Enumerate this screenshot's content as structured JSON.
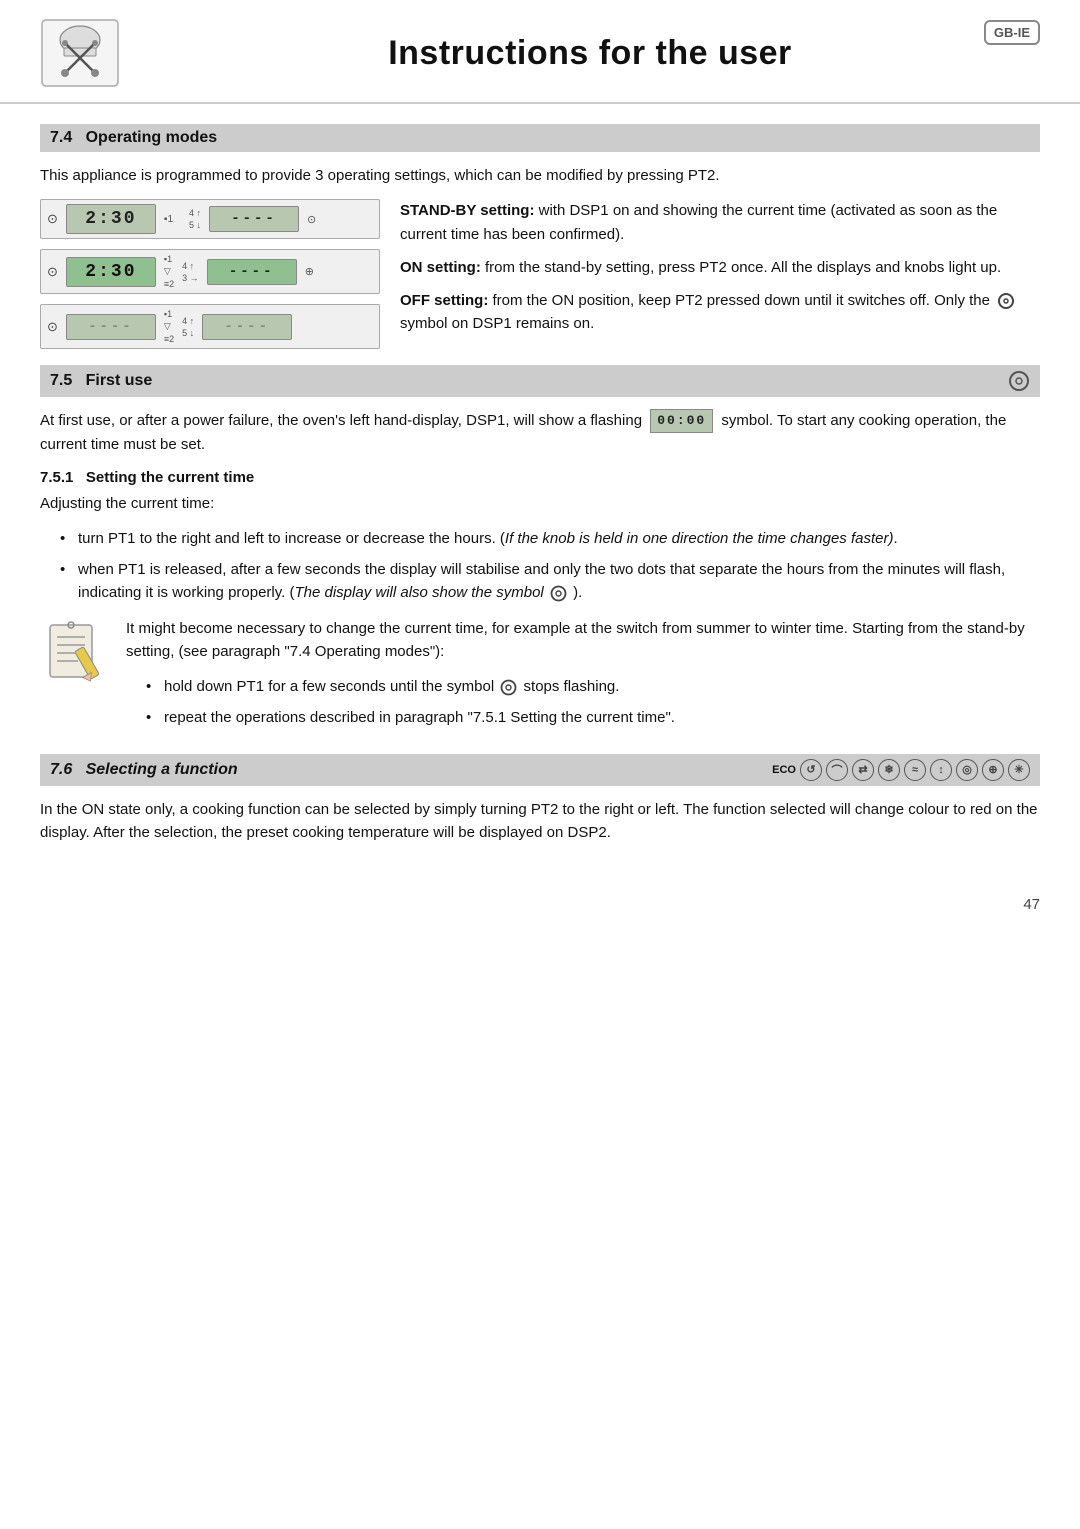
{
  "header": {
    "title": "Instructions for the user",
    "badge": "GB-IE",
    "logo_alt": "chef-hat-logo"
  },
  "section_7_4": {
    "number": "7.4",
    "title": "Operating modes",
    "intro": "This appliance is programmed to provide 3 operating settings, which can be modified by pressing PT2.",
    "stand_by_label": "STAND-BY setting:",
    "stand_by_text": "with DSP1 on and showing the current time (activated as soon as the current time has been confirmed).",
    "on_label": "ON setting:",
    "on_text": "from the stand-by setting, press PT2 once. All the displays and knobs light up.",
    "off_label": "OFF setting:",
    "off_text": "from the ON position, keep PT2 pressed down until it switches off. Only the",
    "off_text2": "symbol on DSP1 remains on.",
    "display1_time": "2:30",
    "display2_time": "2:30",
    "display3_time": "----"
  },
  "section_7_5": {
    "number": "7.5",
    "title": "First use",
    "intro": "At first use, or after a power failure, the oven's left hand-display, DSP1, will show a flashing",
    "intro2": "symbol. To start any cooking operation, the current time must be set.",
    "sub_number": "7.5.1",
    "sub_title": "Setting the current time",
    "adjusting": "Adjusting the current time:",
    "bullet1": "turn PT1 to the right and left to increase or decrease the hours. (",
    "bullet1_italic": "If the knob is held in one direction the time changes faster)",
    "bullet1_end": ".",
    "bullet2a": "when PT1 is released, after a few seconds the display will stabilise and only the two dots that separate the hours from the minutes will flash, indicating it is working properly. (",
    "bullet2_italic": "The display will also show the symbol",
    "bullet2_end": ").",
    "note_text": "It might become necessary to change the current time, for example at the switch from summer to winter time. Starting from the stand-by setting, (see paragraph \"7.4 Operating modes\"):",
    "note_bullet1": "hold down PT1 for a few seconds until the symbol",
    "note_bullet1_end": "stops flashing.",
    "note_bullet2": "repeat the operations described in paragraph \"7.5.1 Setting the current time\"."
  },
  "section_7_6": {
    "number": "7.6",
    "title": "Selecting a function",
    "eco_label": "ECO",
    "intro": "In the ON state only, a cooking function can be selected by simply turning PT2 to the right or left. The function selected will change colour to red on the display. After the selection, the preset cooking temperature will be displayed on DSP2."
  },
  "page_number": "47"
}
